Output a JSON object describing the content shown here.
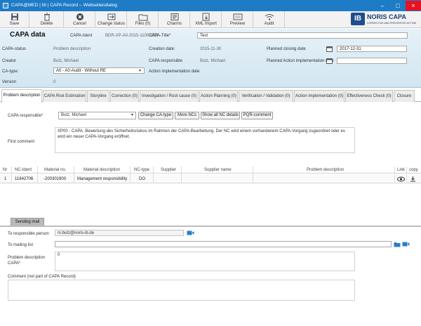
{
  "window": {
    "title": "CAPA@MED | NI | CAPA Record -- Webseitendialog",
    "min": "–",
    "max": "□",
    "close": "×"
  },
  "toolbar": [
    {
      "id": "save",
      "label": "Save",
      "icon": "save-icon"
    },
    {
      "id": "delete",
      "label": "Delete",
      "icon": "trash-icon"
    },
    {
      "id": "cancel",
      "label": "Cancel",
      "icon": "cancel-icon"
    },
    {
      "id": "change_status",
      "label": "Change status",
      "icon": "change-status-icon"
    },
    {
      "id": "files",
      "label": "Files (0)",
      "icon": "folder-icon"
    },
    {
      "id": "charms",
      "label": "Charms",
      "icon": "charms-icon"
    },
    {
      "id": "xml_import",
      "label": "XML Import",
      "icon": "xml-import-icon"
    },
    {
      "id": "preview",
      "label": "Preview",
      "icon": "preview-icon"
    },
    {
      "id": "audit",
      "label": "Audit",
      "icon": "wifi-icon"
    }
  ],
  "logo": {
    "mark": "IB",
    "name": "NORIS CAPA",
    "tagline": "CORRECTIVE AND PREVENTIVE ACTION"
  },
  "header": {
    "title": "CAPA data",
    "capa_ident_label": "CAPA-Ident",
    "capa_ident_value": "BDR-XP-A0-2015-11000253",
    "capa_title_label": "CAPA-Title*",
    "capa_title_value": "Test",
    "capa_status_label": "CAPA-status",
    "capa_status_value": "Problem description",
    "creation_date_label": "Creation date:",
    "creation_date_value": "2015-11-30",
    "planned_closing_label": "Planned closing date",
    "planned_closing_value": "2017-12-31",
    "creator_label": "Creator",
    "creator_value": "Butz, Michael",
    "responsible_label": "CAPA responsible",
    "responsible_value": "Butz, Michael",
    "planned_action_label": "Planned Action implementation date",
    "planned_action_value": "",
    "ca_type_label": "CA-type:",
    "ca_type_value": "A0 - A0-Audit - Without RE",
    "action_impl_label": "Action implementation date",
    "version_label": "Version",
    "version_value": "0"
  },
  "tabs": [
    "Problem description",
    "CAPA Risk Estimation",
    "Storyline",
    "Correction (0)",
    "Investigation / Root cause (0)",
    "Action Planning (0)",
    "Verification / Validation (0)",
    "Action implementation (0)",
    "Effectiveness Check (0)",
    "Closure"
  ],
  "problem": {
    "responsible_label": "CAPA responsible*",
    "responsible_value": "Butz, Michael",
    "buttons": [
      "Change CA-type",
      "More NCs",
      "Show all NC details",
      "PQR-comment"
    ],
    "first_comment_label": "First comment",
    "first_comment_value": "XP00 - CAPA. Bewertung des Sicherheitsrisikos im Rahmen der CAPA-Bearbeitung. Der NC wird einem vorhandenem CAPA-Vorgang zugeordnet oder es wird ein neuer CAPA-Vorgang eröffnet."
  },
  "grid": {
    "columns": [
      "Nr",
      "NC-Ident",
      "Material no.",
      "Material description",
      "NC-type",
      "Supplier",
      "Supplier name",
      "Problem description",
      "Link",
      "copy"
    ],
    "rows": [
      {
        "nr": "1",
        "nc_ident": "11842706",
        "material_no": "-200301900",
        "material_desc": "Management responsibility",
        "nc_type": "DO",
        "supplier": "",
        "supplier_name": "",
        "problem_desc": ""
      }
    ]
  },
  "mail": {
    "tab_label": "Sending mail",
    "to_responsible_label": "To responsible person",
    "to_responsible_value": "m.butz@noris-ib.de",
    "mailing_list_label": "To mailing list",
    "mailing_list_value": "",
    "problem_desc_label": "Problem description CAPA*",
    "problem_desc_value": "0",
    "comment_label": "Comment (not part of CAPA Record)",
    "comment_value": ""
  }
}
